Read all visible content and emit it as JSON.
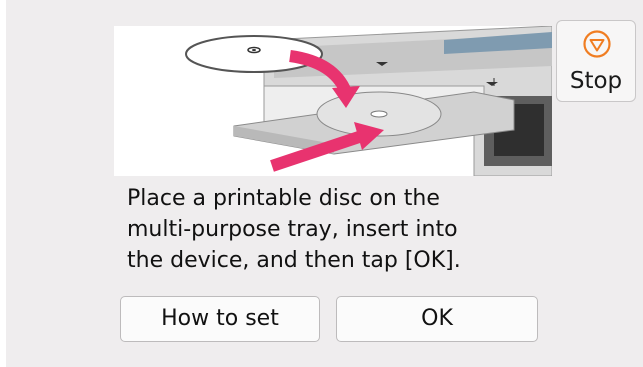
{
  "stop_button": {
    "label": "Stop",
    "icon": "stop-icon",
    "icon_color": "#f07d22"
  },
  "illustration": {
    "description_icon": "disc-tray-insert-illustration",
    "arrow_color": "#e8336f"
  },
  "message": {
    "text": "Place a printable disc on the\nmulti-purpose tray, insert into\nthe device, and then tap [OK]."
  },
  "buttons": {
    "how_to_set": "How to set",
    "ok": "OK"
  }
}
